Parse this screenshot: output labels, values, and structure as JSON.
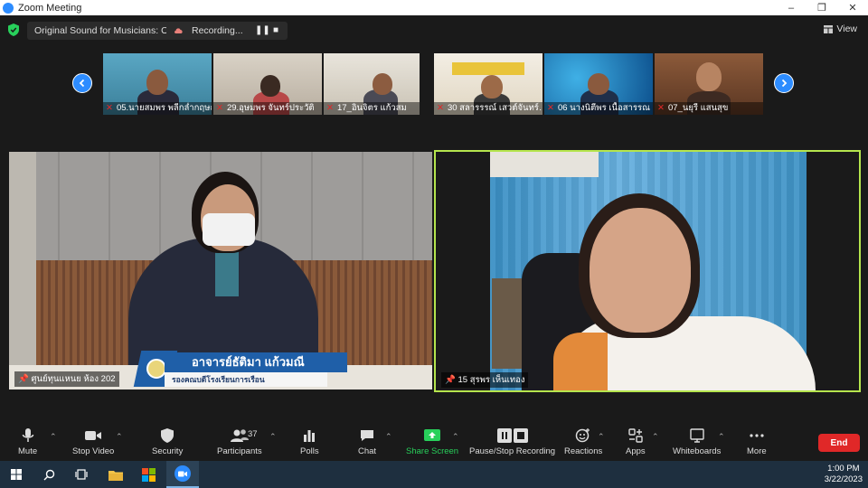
{
  "window": {
    "title": "Zoom Meeting"
  },
  "topbar": {
    "sound_label": "Original Sound for Musicians: Off",
    "recording_label": "Recording...",
    "view_label": "View"
  },
  "thumbnails": [
    {
      "name": "05.นายสมพร พลีกล่ำกฤษณ"
    },
    {
      "name": "29.อุษมพร จันทร์ประวัติ"
    },
    {
      "name": "17_อินจิตร แก้วสม"
    },
    {
      "name": "30 สลารรรณ์ เสวต์จันทร์…"
    },
    {
      "name": "06 นางนิตีพร เนื้อสารรณ"
    },
    {
      "name": "07_นยุรี แสนสุข"
    }
  ],
  "speakers": {
    "left": {
      "name": "ศูนย์ทุนแหนย ห้อง 202",
      "lower_third_name": "อาจารย์ธัติมา แก้วมณี",
      "lower_third_role": "รองคณบดีโรงเรียนการเรือน"
    },
    "right": {
      "name": "15 สุรพร เห็นเทอง"
    }
  },
  "toolbar": {
    "mute": "Mute",
    "stop_video": "Stop Video",
    "security": "Security",
    "participants": "Participants",
    "participants_count": "37",
    "polls": "Polls",
    "chat": "Chat",
    "share_screen": "Share Screen",
    "pause_stop_recording": "Pause/Stop Recording",
    "reactions": "Reactions",
    "apps": "Apps",
    "whiteboards": "Whiteboards",
    "more": "More",
    "end": "End"
  },
  "taskbar": {
    "time": "1:00 PM",
    "date": "3/22/2023"
  },
  "colors": {
    "zoom_blue": "#2d8cff",
    "share_green": "#28d05b",
    "end_red": "#e02828",
    "active_speaker_border": "#b5e54d"
  }
}
